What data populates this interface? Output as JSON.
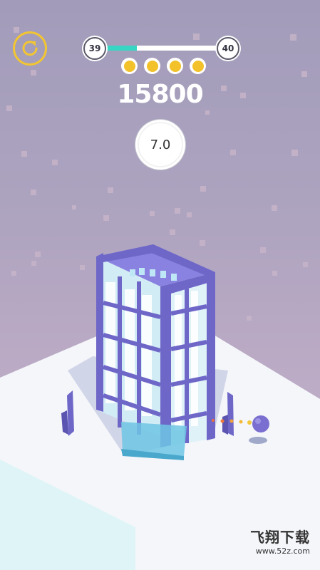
{
  "hud": {
    "restart_icon": "restart-icon",
    "level_current": "39",
    "level_next": "40",
    "level_progress": 0.28,
    "stars_earned": 4,
    "stars_total": 4,
    "score": "15800",
    "multiplier": "7.0"
  },
  "watermark": {
    "name": "飞翔下载",
    "url": "www.52z.com"
  },
  "colors": {
    "accent_yellow": "#f2c533",
    "progress": "#37d6c4",
    "tower_purple": "#6e67c8",
    "glass": "#cdeef8",
    "ball": "#7a6fd0"
  }
}
